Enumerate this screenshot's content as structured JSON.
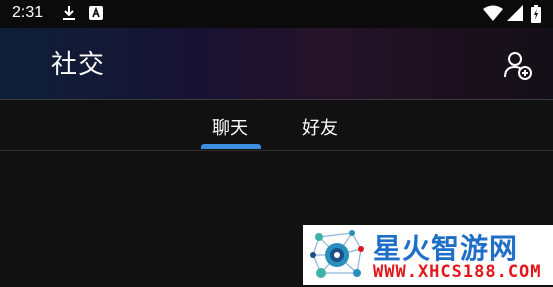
{
  "status_bar": {
    "time": "2:31",
    "icons": [
      "download-icon",
      "a-badge-icon",
      "wifi-icon",
      "signal-icon",
      "battery-charging-icon"
    ]
  },
  "app_bar": {
    "title": "社交",
    "action_icon": "add-friend-icon"
  },
  "tabs": [
    {
      "label": "聊天",
      "selected": true
    },
    {
      "label": "好友",
      "selected": false
    }
  ],
  "colors": {
    "tab_indicator": "#3d8fe0",
    "background": "#111111"
  },
  "watermark": {
    "title": "星火智游网",
    "url": "WWW.XHCS188.COM"
  }
}
